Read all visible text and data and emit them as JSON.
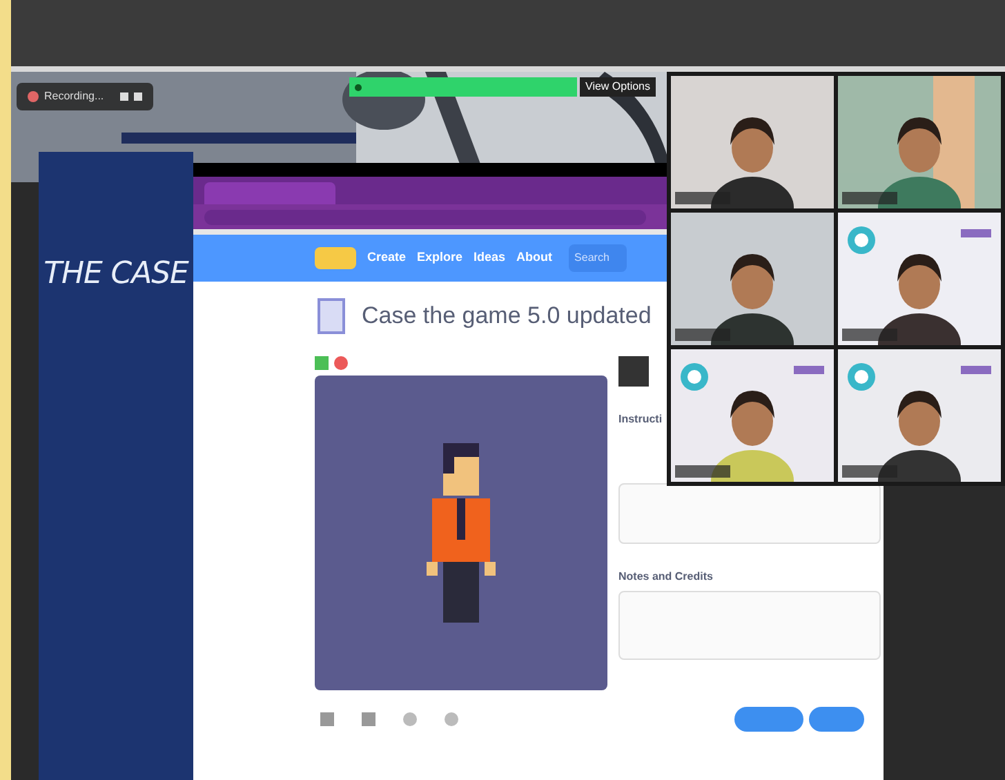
{
  "meeting_bar": {
    "recording_label": "Recording...",
    "view_options": "View Options"
  },
  "slide": {
    "title": "THE CASE"
  },
  "scratch": {
    "nav": [
      {
        "label": "Create"
      },
      {
        "label": "Explore"
      },
      {
        "label": "Ideas"
      },
      {
        "label": "About"
      }
    ],
    "search_placeholder": "Search",
    "project_title": "Case the game 5.0 updated",
    "sections": [
      {
        "heading": "Instructi"
      },
      {
        "heading": "Notes and Credits"
      }
    ]
  }
}
